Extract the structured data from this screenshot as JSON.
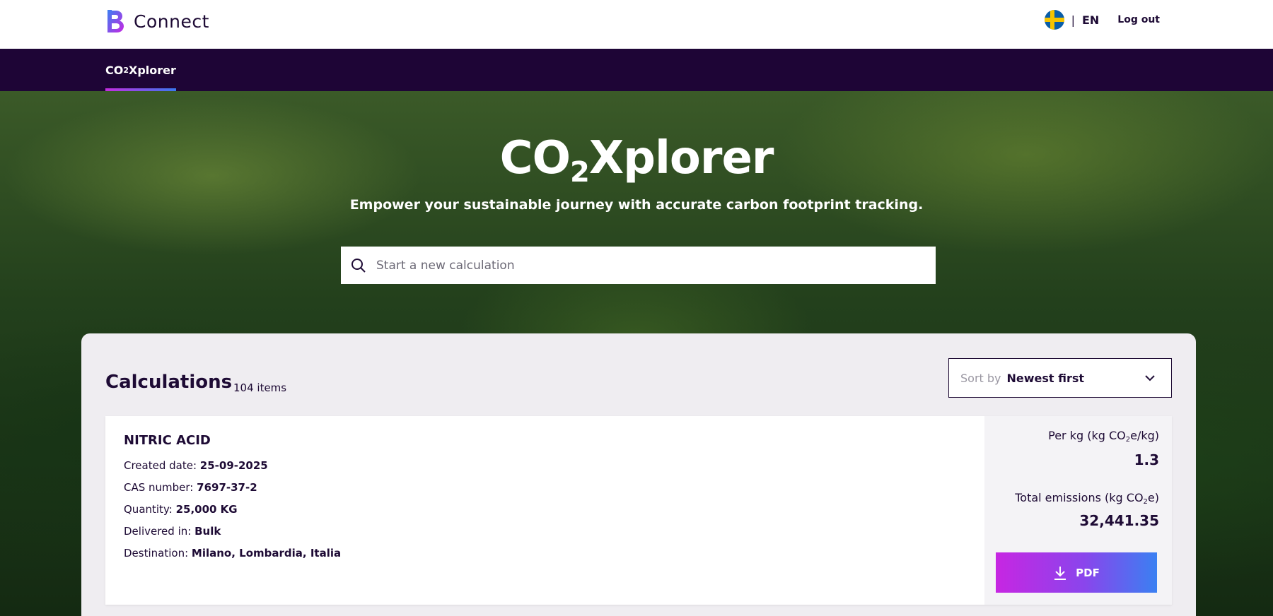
{
  "header": {
    "brand_name": "Connect",
    "language_separator": "|",
    "language": "EN",
    "logout_label": "Log out"
  },
  "nav": {
    "active_tab_prefix": "CO",
    "active_tab_sub": "2",
    "active_tab_suffix": "Xplorer"
  },
  "hero": {
    "title_prefix": "CO",
    "title_sub": "2",
    "title_suffix": "Xplorer",
    "subtitle": "Empower your sustainable journey with accurate carbon footprint tracking."
  },
  "search": {
    "placeholder": "Start a new calculation",
    "value": ""
  },
  "calculations": {
    "title": "Calculations",
    "count": "104 items",
    "sort_label": "Sort by",
    "sort_value": "Newest first",
    "items": [
      {
        "product": "NITRIC ACID",
        "created_label": "Created date:",
        "created_value": "25-09-2025",
        "cas_label": "CAS number:",
        "cas_value": "7697-37-2",
        "quantity_label": "Quantity:",
        "quantity_value": "25,000 KG",
        "delivered_label": "Delivered in:",
        "delivered_value": "Bulk",
        "destination_label": "Destination:",
        "destination_value": "Milano, Lombardia, Italia",
        "per_kg_label_a": "Per kg (kg CO",
        "per_kg_label_sub": "2",
        "per_kg_label_b": "e/kg)",
        "per_kg_value": "1.3",
        "total_label_a": "Total emissions (kg CO",
        "total_label_sub": "2",
        "total_label_b": "e)",
        "total_value": "32,441.35",
        "pdf_label": "PDF"
      }
    ]
  },
  "colors": {
    "navy": "#1e0536",
    "text": "#1e0b35",
    "gradient_start": "#c726e2",
    "gradient_end": "#3a80f2"
  }
}
